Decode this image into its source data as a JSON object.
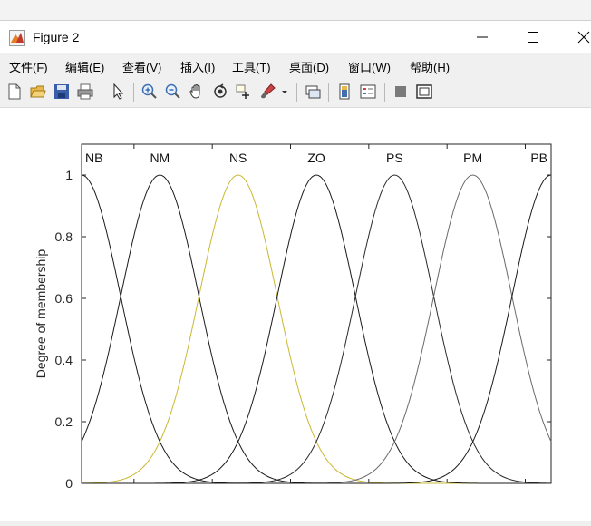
{
  "window": {
    "title": "Figure 2",
    "controls": {
      "minimize": "—",
      "maximize": "☐",
      "close": "✕"
    }
  },
  "menu": [
    {
      "label": "文件(F)"
    },
    {
      "label": "编辑(E)"
    },
    {
      "label": "查看(V)"
    },
    {
      "label": "插入(I)"
    },
    {
      "label": "工具(T)"
    },
    {
      "label": "桌面(D)"
    },
    {
      "label": "窗口(W)"
    },
    {
      "label": "帮助(H)"
    }
  ],
  "toolbar": [
    "new-figure-icon",
    "open-file-icon",
    "save-icon",
    "print-icon",
    "pointer-icon",
    "zoom-in-icon",
    "zoom-out-icon",
    "pan-icon",
    "rotate-3d-icon",
    "data-cursor-icon",
    "brush-icon",
    "dropdown-arrow-icon",
    "link-plot-icon",
    "colorbar-icon",
    "legend-icon",
    "hide-plot-tools-icon",
    "show-plot-tools-icon"
  ],
  "chart_data": {
    "type": "line",
    "title": "",
    "xlabel": "",
    "ylabel": "Degree of membership",
    "xlim": [
      -3,
      3
    ],
    "ylim": [
      0,
      1.1
    ],
    "yticks": [
      "0",
      "0.2",
      "0.4",
      "0.6",
      "0.8",
      "1"
    ],
    "ytick_values": [
      0,
      0.2,
      0.4,
      0.6,
      0.8,
      1
    ],
    "xtick_values": [
      -2.33,
      -1.33,
      -0.33,
      0.67,
      1.67,
      2.67
    ],
    "grid": false,
    "membership_functions": [
      {
        "name": "NB",
        "type": "gaussmf",
        "center": -3,
        "sigma": 0.5,
        "color": "#1a1a1a"
      },
      {
        "name": "NM",
        "type": "gaussmf",
        "center": -2,
        "sigma": 0.5,
        "color": "#1a1a1a"
      },
      {
        "name": "NS",
        "type": "gaussmf",
        "center": -1,
        "sigma": 0.5,
        "color": "#c9b830"
      },
      {
        "name": "ZO",
        "type": "gaussmf",
        "center": 0,
        "sigma": 0.5,
        "color": "#1a1a1a"
      },
      {
        "name": "PS",
        "type": "gaussmf",
        "center": 1,
        "sigma": 0.5,
        "color": "#2a2a2a"
      },
      {
        "name": "PM",
        "type": "gaussmf",
        "center": 2,
        "sigma": 0.5,
        "color": "#6a6a6a"
      },
      {
        "name": "PB",
        "type": "gaussmf",
        "center": 3,
        "sigma": 0.5,
        "color": "#1a1a1a"
      }
    ]
  }
}
